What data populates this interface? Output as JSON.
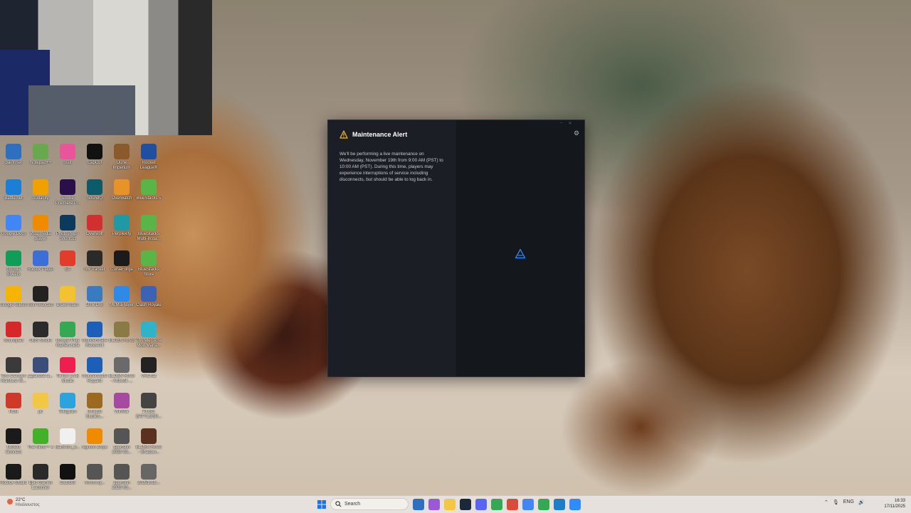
{
  "desktop": {
    "icons": [
      [
        {
          "label": "paint.net",
          "color": "#2f6fbf"
        },
        {
          "label": "Notepad++",
          "color": "#6aa84f"
        },
        {
          "label": "osu!",
          "color": "#e8559b"
        },
        {
          "label": "CapCut",
          "color": "#111111"
        },
        {
          "label": "Dune Imperium",
          "color": "#8b5a2b"
        },
        {
          "label": "Rocket League®",
          "color": "#1e4fa0"
        }
      ],
      [
        {
          "label": "Battle.net",
          "color": "#1a7fd6"
        },
        {
          "label": "Audacity",
          "color": "#f0a000"
        },
        {
          "label": "Adobe Premiere P...",
          "color": "#2a0f4a"
        },
        {
          "label": "SoundQ",
          "color": "#0d5a6b"
        },
        {
          "label": "Overwatch",
          "color": "#e8932a"
        },
        {
          "label": "BlueStacks 5",
          "color": "#59b548"
        }
      ],
      [
        {
          "label": "Google Docs",
          "color": "#4285f4"
        },
        {
          "label": "VLC media player",
          "color": "#f08a00"
        },
        {
          "label": "Photoshop - Shortcut",
          "color": "#0b3a5c"
        },
        {
          "label": "Overwolf",
          "color": "#d23030"
        },
        {
          "label": "Perplexity",
          "color": "#1f9aa5"
        },
        {
          "label": "BlueStacks Multi-Insta...",
          "color": "#59b548"
        }
      ],
      [
        {
          "label": "Google Sheets",
          "color": "#0f9d58"
        },
        {
          "label": "Roblox Player",
          "color": "#3a6fd8"
        },
        {
          "label": "EA",
          "color": "#e23d2b"
        },
        {
          "label": "R6 Tracker",
          "color": "#2a2a2a"
        },
        {
          "label": "CurseForge",
          "color": "#1b1b1b"
        },
        {
          "label": "BlueStacks Store",
          "color": "#59b548"
        }
      ],
      [
        {
          "label": "Google Slides",
          "color": "#f4b400"
        },
        {
          "label": "Iriun Webcam",
          "color": "#222222"
        },
        {
          "label": "Brawl Stars",
          "color": "#f2c230"
        },
        {
          "label": "Disk Drill",
          "color": "#3a7ac0"
        },
        {
          "label": "MuMuPlayer",
          "color": "#2e8ae6"
        },
        {
          "label": "Clash Royale",
          "color": "#3b62b3"
        }
      ],
      [
        {
          "label": "Soundpad",
          "color": "#d62828"
        },
        {
          "label": "OBS Studio",
          "color": "#2b2b2b"
        },
        {
          "label": "Google Play Games beta",
          "color": "#34a853"
        },
        {
          "label": "Wondershare Recoverit",
          "color": "#1d5fb8"
        },
        {
          "label": "ELDEN RING",
          "color": "#8a7a45"
        },
        {
          "label": "Thunderstore Mod Mana...",
          "color": "#2fb3c9"
        }
      ],
      [
        {
          "label": "Tom Clancy's Rainbow Si...",
          "color": "#3a3a3a"
        },
        {
          "label": "japanese-a...",
          "color": "#3b4d7a"
        },
        {
          "label": "TikTok LIVE Studio",
          "color": "#ee1d52"
        },
        {
          "label": "Wondershare Repairit",
          "color": "#1d5fb8"
        },
        {
          "label": "ELDEN RING - Artbook ...",
          "color": "#6a6a6a"
        },
        {
          "label": "VRChat",
          "color": "#222222"
        }
      ],
      [
        {
          "label": "Rust",
          "color": "#cd3a2a"
        },
        {
          "label": "pc",
          "color": "#f2c744"
        },
        {
          "label": "Telegram",
          "color": "#2aa3df"
        },
        {
          "label": "Intrepid Studios...",
          "color": "#9b6a20"
        },
        {
          "label": "WinRar",
          "color": "#a54aa0"
        },
        {
          "label": "PUBG BATTLEGR...",
          "color": "#444444"
        }
      ],
      [
        {
          "label": "Ubisoft Connect",
          "color": "#1a1a1a"
        },
        {
          "label": "The Sims™ 4",
          "color": "#43b02a"
        },
        {
          "label": "BatShim_8...",
          "color": "#f0f0f0"
        },
        {
          "label": "nightrin 2mp4",
          "color": "#f08a00"
        },
        {
          "label": "sportsrin 2025-03...",
          "color": "#555555"
        },
        {
          "label": "ELDEN RING - Shadow...",
          "color": "#5a3020"
        }
      ],
      [
        {
          "label": "Roblox Studio",
          "color": "#1a1a1a"
        },
        {
          "label": "Epic Games Launcher",
          "color": "#2a2a2a"
        },
        {
          "label": "ClubGG",
          "color": "#111111"
        },
        {
          "label": "nrmm.ny...",
          "color": "#555555"
        },
        {
          "label": "sportsrin 2025-03...",
          "color": "#555555"
        },
        {
          "label": "20251016...",
          "color": "#666666"
        }
      ]
    ]
  },
  "dialog": {
    "title": "Maintenance Alert",
    "message": "We'll be performing a live maintenance on Wednesday, November 19th from 9:00 AM (PST) to 10:00 AM (PST). During this time, players may experience interruptions of service including disconnects, but should be able to log back in.",
    "icons": {
      "warning": "warning-triangle-icon",
      "settings": "gear-icon",
      "loading": "loading-spinner-icon"
    },
    "colors": {
      "warning": "#f0b429",
      "spinner": "#2d8cff"
    }
  },
  "taskbar": {
    "weather": {
      "temp": "22°C",
      "condition": "Ηλιόλουστος"
    },
    "search_placeholder": "Search",
    "clock": {
      "time": "16:33",
      "date": "17/11/2025"
    },
    "tray_lang": "ENG"
  }
}
